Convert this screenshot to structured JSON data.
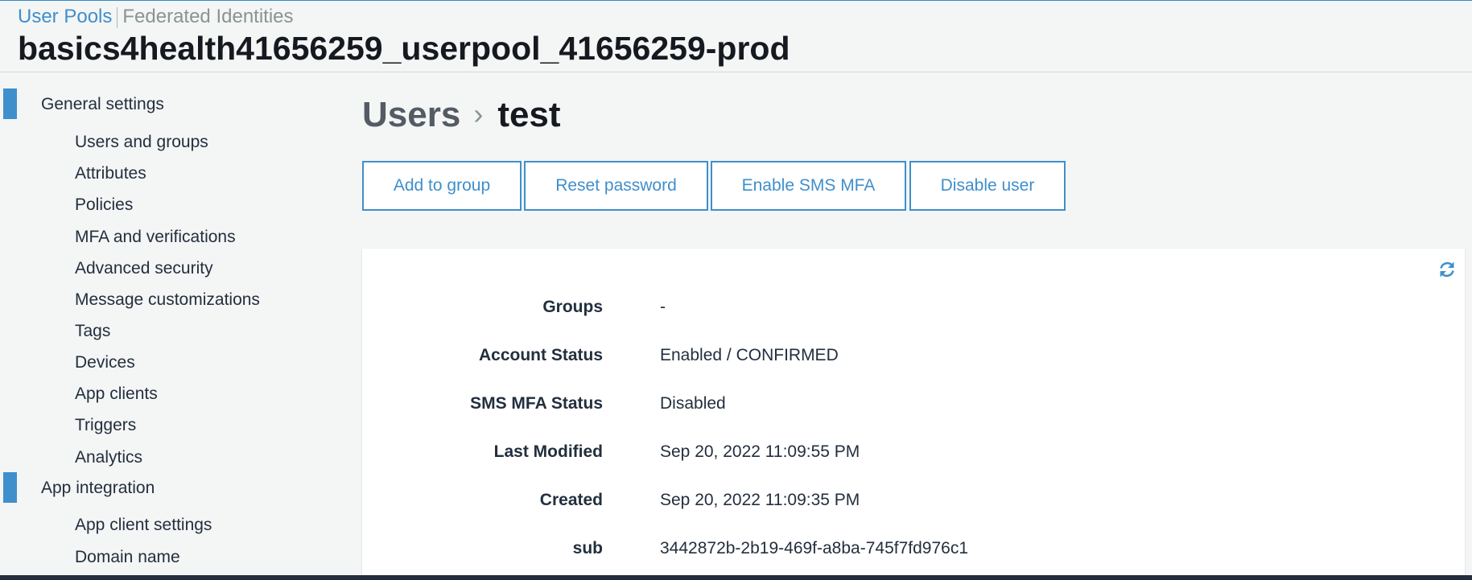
{
  "header": {
    "tabs": [
      {
        "label": "User Pools"
      },
      {
        "label": "Federated Identities"
      }
    ],
    "pool_name": "basics4health41656259_userpool_41656259-prod"
  },
  "sidebar": {
    "sections": [
      {
        "label": "General settings",
        "items": [
          {
            "label": "Users and groups"
          },
          {
            "label": "Attributes"
          },
          {
            "label": "Policies"
          },
          {
            "label": "MFA and verifications"
          },
          {
            "label": "Advanced security"
          },
          {
            "label": "Message customizations"
          },
          {
            "label": "Tags"
          },
          {
            "label": "Devices"
          },
          {
            "label": "App clients"
          },
          {
            "label": "Triggers"
          },
          {
            "label": "Analytics"
          }
        ]
      },
      {
        "label": "App integration",
        "items": [
          {
            "label": "App client settings"
          },
          {
            "label": "Domain name"
          }
        ]
      }
    ]
  },
  "breadcrumb": {
    "parent": "Users",
    "separator": "›",
    "current": "test"
  },
  "actions": {
    "add_to_group": "Add to group",
    "reset_password": "Reset password",
    "enable_sms_mfa": "Enable SMS MFA",
    "disable_user": "Disable user"
  },
  "details": [
    {
      "label": "Groups",
      "value": "-"
    },
    {
      "label": "Account Status",
      "value": "Enabled / CONFIRMED"
    },
    {
      "label": "SMS MFA Status",
      "value": "Disabled"
    },
    {
      "label": "Last Modified",
      "value": "Sep 20, 2022 11:09:55 PM"
    },
    {
      "label": "Created",
      "value": "Sep 20, 2022 11:09:35 PM"
    },
    {
      "label": "sub",
      "value": "3442872b-2b19-469f-a8ba-745f7fd976c1"
    }
  ],
  "icons": {
    "refresh": "refresh-icon"
  },
  "colors": {
    "accent": "#3f8fcc",
    "background": "#f4f5f5",
    "panel": "#ffffff",
    "text": "#232f3e",
    "footer": "#232f3e"
  }
}
